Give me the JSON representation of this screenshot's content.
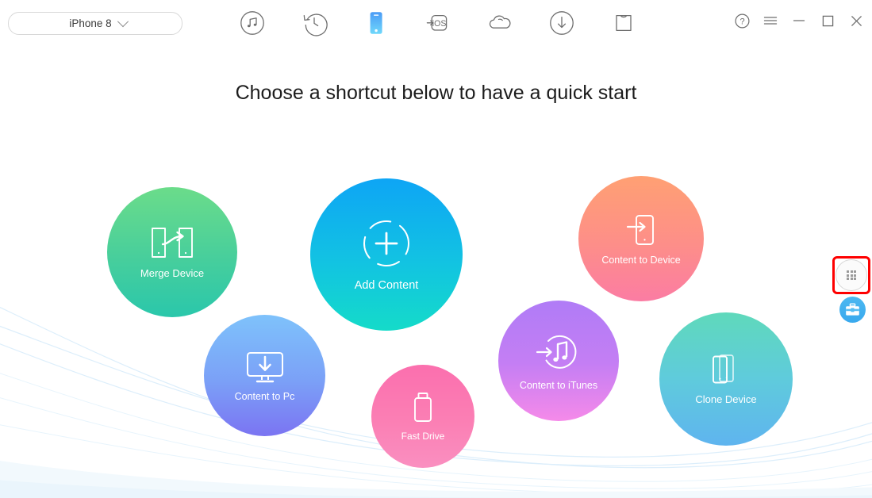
{
  "window": {
    "device_selector": {
      "apple_glyph": "",
      "device_name": "iPhone 8"
    },
    "controls": [
      {
        "name": "help",
        "glyph": "?"
      },
      {
        "name": "menu",
        "glyph": "☰"
      },
      {
        "name": "minimize",
        "glyph": "−"
      },
      {
        "name": "maximize",
        "glyph": "□"
      },
      {
        "name": "close",
        "glyph": "✕"
      }
    ]
  },
  "toolbar": {
    "items": [
      {
        "id": "music",
        "icon": "music-circle-icon",
        "active": false
      },
      {
        "id": "restore",
        "icon": "history-clock-icon",
        "active": false
      },
      {
        "id": "device",
        "icon": "phone-icon",
        "active": true
      },
      {
        "id": "to-ios",
        "icon": "to-ios-icon",
        "label": "iOS",
        "active": false
      },
      {
        "id": "cloud",
        "icon": "cloud-icon",
        "active": false
      },
      {
        "id": "download",
        "icon": "download-circle-icon",
        "active": false
      },
      {
        "id": "toolkit",
        "icon": "tshirt-icon",
        "active": false
      }
    ]
  },
  "main": {
    "headline": "Choose a shortcut below to have a quick start",
    "shortcuts": [
      {
        "id": "merge-device",
        "label": "Merge Device",
        "icon": "two-phones-arrow-icon",
        "color_from": "#6bdc8a",
        "color_to": "#2ac7ab"
      },
      {
        "id": "add-content",
        "label": "Add Content",
        "icon": "plus-dashed-circle-icon",
        "color_from": "#0ea5f5",
        "color_to": "#14dbc9"
      },
      {
        "id": "content-to-device",
        "label": "Content to Device",
        "icon": "arrow-into-phone-icon",
        "color_from": "#ffa073",
        "color_to": "#fb7ca3"
      },
      {
        "id": "content-to-pc",
        "label": "Content to Pc",
        "icon": "monitor-download-icon",
        "color_from": "#7ec2fb",
        "color_to": "#7b74f2"
      },
      {
        "id": "fast-drive",
        "label": "Fast Drive",
        "icon": "usb-drive-icon",
        "color_from": "#fb6fae",
        "color_to": "#fa8fc0"
      },
      {
        "id": "content-to-itunes",
        "label": "Content to iTunes",
        "icon": "arrow-music-circle-icon",
        "color_from": "#b07cf6",
        "color_to": "#f58ae9"
      },
      {
        "id": "clone-device",
        "label": "Clone Device",
        "icon": "two-phones-icon",
        "color_from": "#5fd9bb",
        "color_to": "#5fb4ef"
      }
    ]
  },
  "side_widgets": {
    "apps_button": {
      "icon": "apps-grid-icon",
      "highlight_color": "#fe0000"
    },
    "toolbox_button": {
      "icon": "toolbox-icon",
      "color": "#39a9ee"
    }
  }
}
